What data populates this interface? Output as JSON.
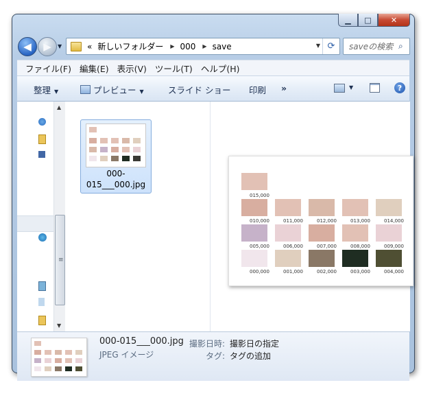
{
  "window": {
    "caption_buttons": {
      "minimize": "▁",
      "maximize": "□",
      "close": "✕"
    }
  },
  "address": {
    "back_glyph": "◀",
    "forward_glyph": "▶",
    "chevron_left": "«",
    "breadcrumbs": [
      "新しいフォルダー",
      "000",
      "save"
    ],
    "separator": "▶"
  },
  "search": {
    "placeholder": "saveの検索"
  },
  "menu": [
    "ファイル(F)",
    "編集(E)",
    "表示(V)",
    "ツール(T)",
    "ヘルプ(H)"
  ],
  "toolbar": {
    "organize": "整理",
    "preview": "プレビュー",
    "slideshow": "スライド ショー",
    "print": "印刷",
    "more": "»",
    "help": "?"
  },
  "file": {
    "name": "000-015___000.jpg"
  },
  "preview_labels": {
    "row0": [
      "015,000"
    ],
    "row1": [
      "010,000",
      "011,000",
      "012,000",
      "013,000",
      "014,000"
    ],
    "row2": [
      "005,000",
      "006,000",
      "007,000",
      "008,000",
      "009,000"
    ],
    "row3": [
      "000,000",
      "001,000",
      "002,000",
      "003,000",
      "004,000"
    ]
  },
  "details": {
    "filename": "000-015___000.jpg",
    "type": "JPEG イメージ",
    "date_label": "撮影日時:",
    "date_value": "撮影日の指定",
    "tags_label": "タグ:",
    "tags_value": "タグの追加"
  }
}
